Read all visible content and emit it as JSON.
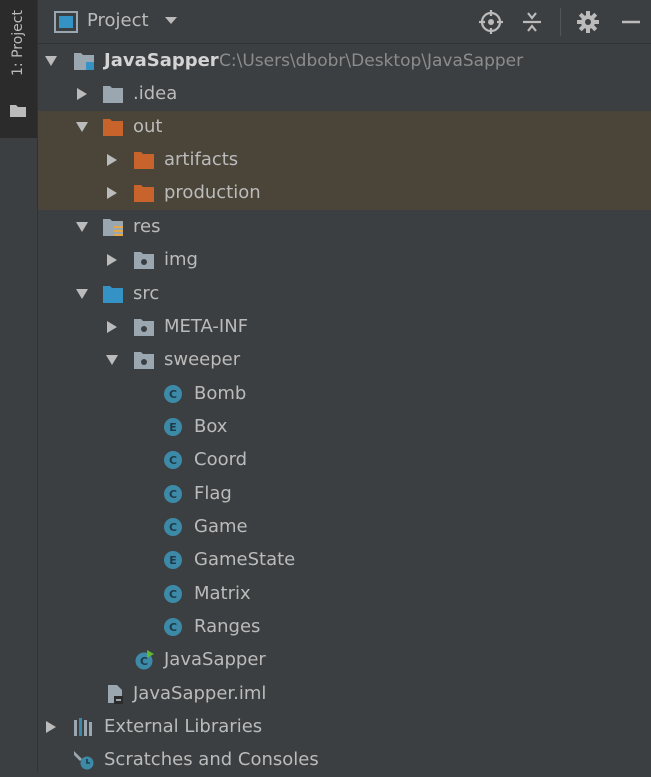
{
  "side_tab": {
    "label": "1: Project"
  },
  "header": {
    "title": "Project"
  },
  "colors": {
    "background": "#3c3f41",
    "folder_gray": "#a9b7c6",
    "folder_orange": "#c8632c",
    "folder_blue": "#3592c4",
    "class_teal": "#3d8aa8",
    "highlight": "#4a4538"
  },
  "tree": {
    "root": {
      "label": "JavaSapper",
      "path": "C:\\Users\\dbobr\\Desktop\\JavaSapper"
    },
    "idea": {
      "label": ".idea"
    },
    "out": {
      "label": "out"
    },
    "artifacts": {
      "label": "artifacts"
    },
    "production": {
      "label": "production"
    },
    "res": {
      "label": "res"
    },
    "img": {
      "label": "img"
    },
    "src": {
      "label": "src"
    },
    "meta_inf": {
      "label": "META-INF"
    },
    "sweeper": {
      "label": "sweeper"
    },
    "files": [
      {
        "label": "Bomb",
        "kind": "C"
      },
      {
        "label": "Box",
        "kind": "E"
      },
      {
        "label": "Coord",
        "kind": "C"
      },
      {
        "label": "Flag",
        "kind": "C"
      },
      {
        "label": "Game",
        "kind": "C"
      },
      {
        "label": "GameState",
        "kind": "E"
      },
      {
        "label": "Matrix",
        "kind": "C"
      },
      {
        "label": "Ranges",
        "kind": "C"
      }
    ],
    "main_class": {
      "label": "JavaSapper"
    },
    "iml": {
      "label": "JavaSapper.iml"
    },
    "external_libraries": {
      "label": "External Libraries"
    },
    "scratches": {
      "label": "Scratches and Consoles"
    }
  }
}
